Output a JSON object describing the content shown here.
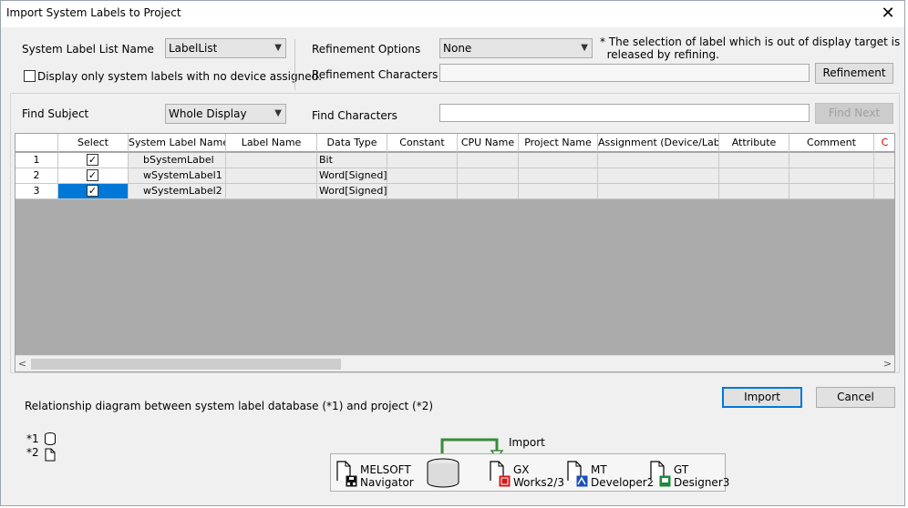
{
  "window": {
    "title": "Import System Labels to Project",
    "close_glyph": "✕"
  },
  "filters": {
    "list_name_label": "System Label List Name",
    "list_name_value": "LabelList",
    "no_device_checkbox_label": "Display only system labels with no device assigned.",
    "no_device_checked": false,
    "refinement_options_label": "Refinement Options",
    "refinement_options_value": "None",
    "refinement_note": "* The selection of label which is out of display target is\n  released by refining.",
    "refinement_chars_label": "Refinement Characters",
    "refinement_chars_value": "",
    "refinement_button": "Refinement"
  },
  "find": {
    "subject_label": "Find Subject",
    "subject_value": "Whole Display",
    "chars_label": "Find Characters",
    "chars_value": "",
    "find_next_button": "Find Next"
  },
  "table": {
    "columns": [
      "",
      "Select",
      "System Label Name",
      "Label Name",
      "Data Type",
      "Constant",
      "CPU Name",
      "Project Name",
      "Assignment (Device/Label)",
      "Attribute",
      "Comment",
      "C"
    ],
    "rows": [
      {
        "num": "1",
        "selected": true,
        "system_label": "bSystemLabel",
        "label": "",
        "data_type": "Bit"
      },
      {
        "num": "2",
        "selected": true,
        "system_label": "wSystemLabel1",
        "label": "",
        "data_type": "Word[Signed]"
      },
      {
        "num": "3",
        "selected": true,
        "system_label": "wSystemLabel2",
        "label": "",
        "data_type": "Word[Signed]"
      }
    ],
    "check_glyph": "✓",
    "scroll_left_glyph": "<",
    "scroll_right_glyph": ">"
  },
  "buttons": {
    "import": "Import",
    "cancel": "Cancel"
  },
  "diagram": {
    "caption": "Relationship diagram between system label database (*1) and project (*2)",
    "legend_db": "*1",
    "legend_project": "*2",
    "import_label": "Import",
    "items": [
      {
        "line1": "MELSOFT",
        "line2": "Navigator"
      },
      {
        "line1": "GX",
        "line2": "Works2/3"
      },
      {
        "line1": "MT",
        "line2": "Developer2"
      },
      {
        "line1": "GT",
        "line2": "Designer3"
      }
    ]
  },
  "colors": {
    "selection": "#0078d7",
    "grid_empty": "#ababab",
    "arrow_green": "#3a8a3a"
  }
}
